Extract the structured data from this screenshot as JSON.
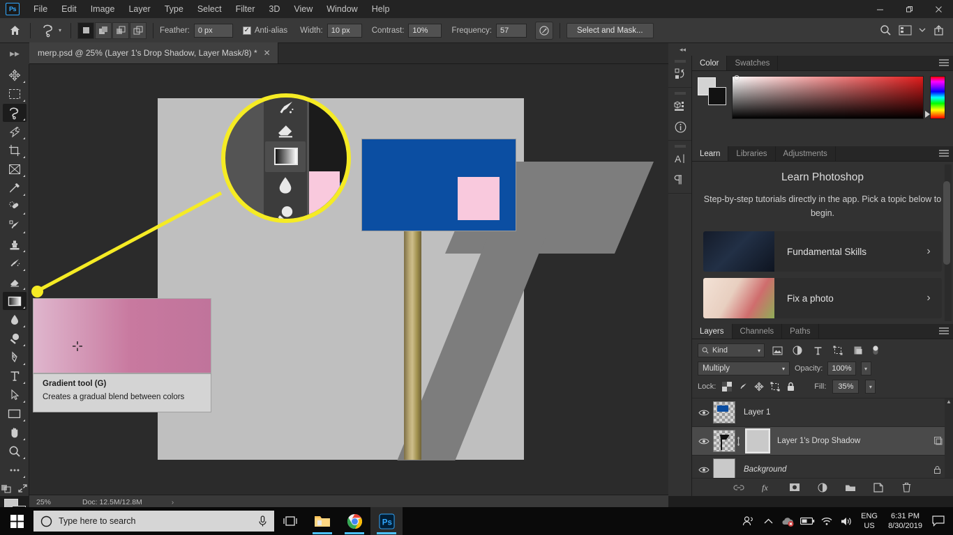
{
  "app": {
    "logo_text": "Ps"
  },
  "menubar": {
    "items": [
      {
        "label": "File"
      },
      {
        "label": "Edit"
      },
      {
        "label": "Image"
      },
      {
        "label": "Layer"
      },
      {
        "label": "Type"
      },
      {
        "label": "Select"
      },
      {
        "label": "Filter"
      },
      {
        "label": "3D"
      },
      {
        "label": "View"
      },
      {
        "label": "Window"
      },
      {
        "label": "Help"
      }
    ]
  },
  "window_controls": {
    "minimize": "—",
    "maximize": "❐",
    "close": "✕"
  },
  "options_bar": {
    "home_icon": "home-icon",
    "tool_preset_icon": "lasso-tool-icon",
    "selection_modes": [
      "new-selection",
      "add-to-selection",
      "subtract-from-selection",
      "intersect-with-selection"
    ],
    "feather_label": "Feather:",
    "feather_value": "0 px",
    "antialias_label": "Anti-alias",
    "antialias_checked": true,
    "width_label": "Width:",
    "width_value": "10 px",
    "contrast_label": "Contrast:",
    "contrast_value": "10%",
    "frequency_label": "Frequency:",
    "frequency_value": "57",
    "pressure_icon": "pen-pressure-icon",
    "select_and_mask_label": "Select and Mask...",
    "right_icons": [
      "search-icon",
      "workspace-icon",
      "chevron-down-icon",
      "share-icon"
    ]
  },
  "document": {
    "tab_title": "merp.psd @ 25% (Layer 1's Drop Shadow, Layer Mask/8) *",
    "close_glyph": "✕"
  },
  "toolbar": {
    "tools": [
      {
        "name": "move-tool",
        "active": false
      },
      {
        "name": "rectangular-marquee-tool",
        "active": false
      },
      {
        "name": "lasso-tool",
        "active": true
      },
      {
        "name": "object-selection-tool",
        "active": false
      },
      {
        "name": "crop-tool",
        "active": false
      },
      {
        "name": "frame-tool",
        "active": false
      },
      {
        "name": "eyedropper-tool",
        "active": false
      },
      {
        "name": "spot-healing-brush-tool",
        "active": false
      },
      {
        "name": "brush-tool",
        "active": false
      },
      {
        "name": "clone-stamp-tool",
        "active": false
      },
      {
        "name": "history-brush-tool",
        "active": false
      },
      {
        "name": "eraser-tool",
        "active": false
      },
      {
        "name": "gradient-tool",
        "active": true
      },
      {
        "name": "blur-tool",
        "active": false
      },
      {
        "name": "dodge-tool",
        "active": false
      },
      {
        "name": "pen-tool",
        "active": false
      },
      {
        "name": "horizontal-type-tool",
        "active": false
      },
      {
        "name": "path-selection-tool",
        "active": false
      },
      {
        "name": "rectangle-tool",
        "active": false
      },
      {
        "name": "hand-tool",
        "active": false
      },
      {
        "name": "zoom-tool",
        "active": false
      },
      {
        "name": "edit-toolbar-tool",
        "active": false
      }
    ],
    "quickmask_icon": "quick-mask-icon",
    "screenmode_icon": "screen-mode-icon",
    "foreground_color": "#c9c9c9",
    "background_color": "#1f1f1f"
  },
  "canvas": {
    "tooltip": {
      "title": "Gradient tool (G)",
      "description": "Creates a gradual blend between colors"
    },
    "gradient_preview": {
      "from": "#dfb6cd",
      "to": "#c0749b"
    },
    "callout_color": "#f5eb24",
    "sign_color": "#0b4ea2",
    "sign_accent_color": "#f9c9dd",
    "background_color": "#bfbfbf",
    "shadow_color": "#7d7d7d"
  },
  "status_bar": {
    "zoom": "25%",
    "doc": "Doc: 12.5M/12.8M",
    "arrow": "›"
  },
  "rail": {
    "collapse_glyph": "◂◂",
    "icons": [
      "history-icon",
      "3d-panel-icon",
      "info-icon",
      "character-icon",
      "paragraph-icon"
    ]
  },
  "color_panel": {
    "tabs": [
      {
        "label": "Color",
        "active": true
      },
      {
        "label": "Swatches",
        "active": false
      }
    ],
    "menu_icon": "panel-menu-icon",
    "foreground": "#d3d3d3",
    "background": "#121212"
  },
  "learn_panel": {
    "tabs": [
      {
        "label": "Learn",
        "active": true
      },
      {
        "label": "Libraries",
        "active": false
      },
      {
        "label": "Adjustments",
        "active": false
      }
    ],
    "menu_icon": "panel-menu-icon",
    "title": "Learn Photoshop",
    "subtitle": "Step-by-step tutorials directly in the app. Pick a topic below to begin.",
    "cards": [
      {
        "label": "Fundamental Skills",
        "chevron": "›"
      },
      {
        "label": "Fix a photo",
        "chevron": "›"
      }
    ]
  },
  "layers_panel": {
    "tabs": [
      {
        "label": "Layers",
        "active": true
      },
      {
        "label": "Channels",
        "active": false
      },
      {
        "label": "Paths",
        "active": false
      }
    ],
    "menu_icon": "panel-menu-icon",
    "filter_label": "Kind",
    "filter_icons": [
      "pixel-layer-filter-icon",
      "adjustment-layer-filter-icon",
      "type-layer-filter-icon",
      "shape-layer-filter-icon",
      "smart-object-filter-icon"
    ],
    "blend_mode": "Multiply",
    "opacity_label": "Opacity:",
    "opacity_value": "100%",
    "lock_label": "Lock:",
    "lock_icons": [
      "lock-transparent-pixels-icon",
      "lock-image-pixels-icon",
      "lock-position-icon",
      "lock-artboard-icon",
      "lock-all-icon"
    ],
    "fill_label": "Fill:",
    "fill_value": "35%",
    "layers": [
      {
        "name": "Layer 1",
        "visible": true,
        "selected": false,
        "italic": false,
        "has_mask": false,
        "locked": false
      },
      {
        "name": "Layer 1's Drop Shadow",
        "visible": true,
        "selected": true,
        "italic": false,
        "has_mask": true,
        "locked": false
      },
      {
        "name": "Background",
        "visible": true,
        "selected": false,
        "italic": true,
        "has_mask": false,
        "locked": true
      }
    ],
    "footer_icons": [
      "link-layers-icon",
      "layer-style-icon",
      "layer-mask-icon",
      "new-fill-adjustment-icon",
      "new-group-icon",
      "new-layer-icon",
      "delete-layer-icon"
    ]
  },
  "taskbar": {
    "start_icon": "windows-start-icon",
    "search_placeholder": "Type here to search",
    "search_icon": "search-circle-icon",
    "mic_icon": "microphone-icon",
    "taskview_icon": "task-view-icon",
    "apps": [
      {
        "name": "file-explorer-icon",
        "open": true,
        "active": false
      },
      {
        "name": "google-chrome-icon",
        "open": true,
        "active": false
      },
      {
        "name": "photoshop-icon",
        "open": true,
        "active": true
      }
    ],
    "tray": {
      "people_icon": "people-icon",
      "chevron_icon": "show-hidden-icons-icon",
      "onedrive_icon": "onedrive-error-icon",
      "battery_icon": "battery-icon",
      "wifi_icon": "wifi-icon",
      "volume_icon": "volume-icon",
      "lang_line1": "ENG",
      "lang_line2": "US",
      "time": "6:31 PM",
      "date": "8/30/2019",
      "notification_icon": "notification-center-icon"
    }
  }
}
